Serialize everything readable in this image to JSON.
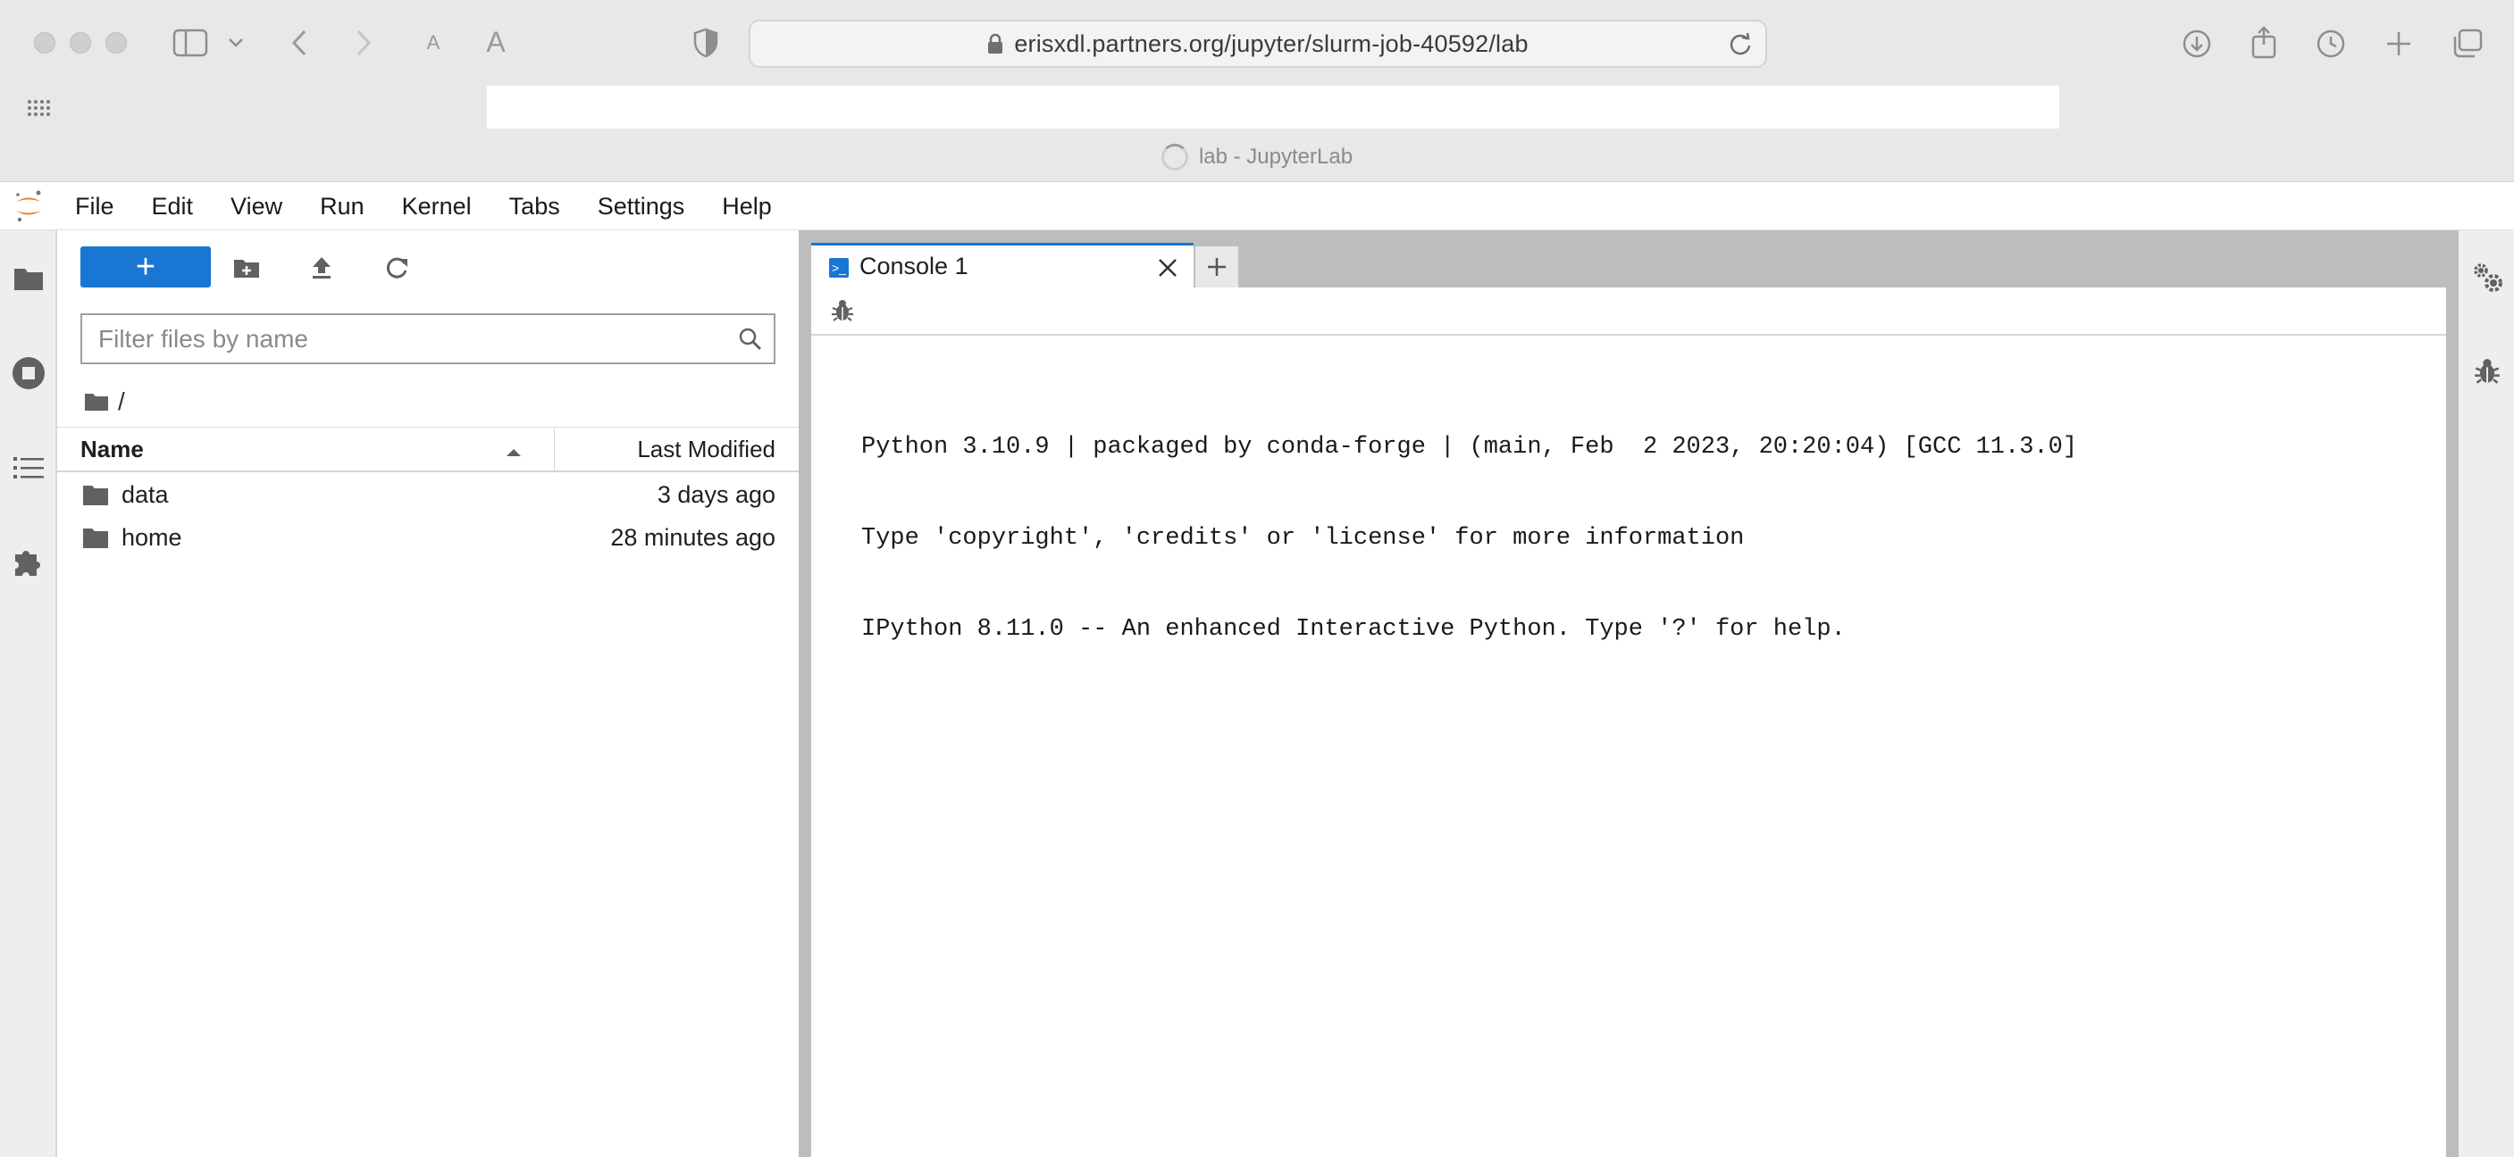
{
  "browser": {
    "url": "erisxdl.partners.org/jupyter/slurm-job-40592/lab",
    "page_title": "lab - JupyterLab",
    "reader_small_a": "A",
    "reader_large_a": "A"
  },
  "menubar": {
    "items": [
      "File",
      "Edit",
      "View",
      "Run",
      "Kernel",
      "Tabs",
      "Settings",
      "Help"
    ]
  },
  "filebrowser": {
    "new_button_label": "+",
    "filter_placeholder": "Filter files by name",
    "breadcrumb": "/",
    "columns": {
      "name": "Name",
      "modified": "Last Modified"
    },
    "items": [
      {
        "name": "data",
        "modified": "3 days ago"
      },
      {
        "name": "home",
        "modified": "28 minutes ago"
      }
    ]
  },
  "tabs": {
    "console": "Console 1",
    "console_icon": ">_"
  },
  "console": {
    "banner": [
      "Python 3.10.9 | packaged by conda-forge | (main, Feb  2 2023, 20:20:04) [GCC 11.3.0]",
      "Type 'copyright', 'credits' or 'license' for more information",
      "IPython 8.11.0 -- An enhanced Interactive Python. Type '?' for help."
    ]
  },
  "colors": {
    "accent": "#1976d2",
    "jupyter_orange": "#f37726",
    "panel_gray": "#bdbdbd"
  }
}
